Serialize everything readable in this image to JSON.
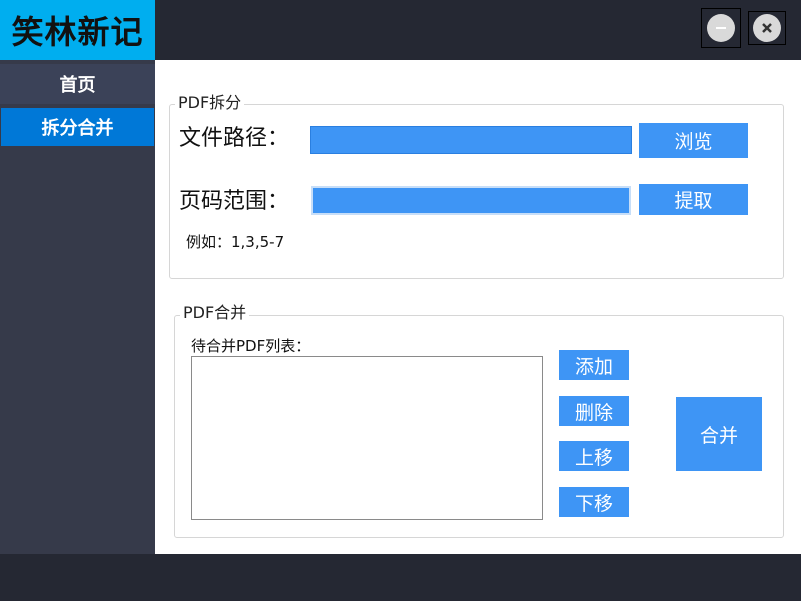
{
  "app": {
    "logo_text": "笑林新记"
  },
  "window": {
    "minimize_glyph": "–",
    "close_glyph": "✕"
  },
  "sidebar": {
    "items": [
      {
        "label": "首页"
      },
      {
        "label": "拆分合并"
      }
    ]
  },
  "split": {
    "title": "PDF拆分",
    "file_path_label": "文件路径：",
    "file_path_value": "",
    "browse_label": "浏览",
    "page_range_label": "页码范围：",
    "page_range_value": "",
    "extract_label": "提取",
    "example_text": "例如：1,3,5-7"
  },
  "merge": {
    "title": "PDF合并",
    "list_label": "待合并PDF列表：",
    "add_label": "添加",
    "delete_label": "删除",
    "up_label": "上移",
    "down_label": "下移",
    "merge_label": "合并"
  },
  "colors": {
    "accent": "#3e95f5",
    "logo_bg": "#00aeef",
    "nav_active": "#0078d7",
    "dark": "#252833"
  }
}
